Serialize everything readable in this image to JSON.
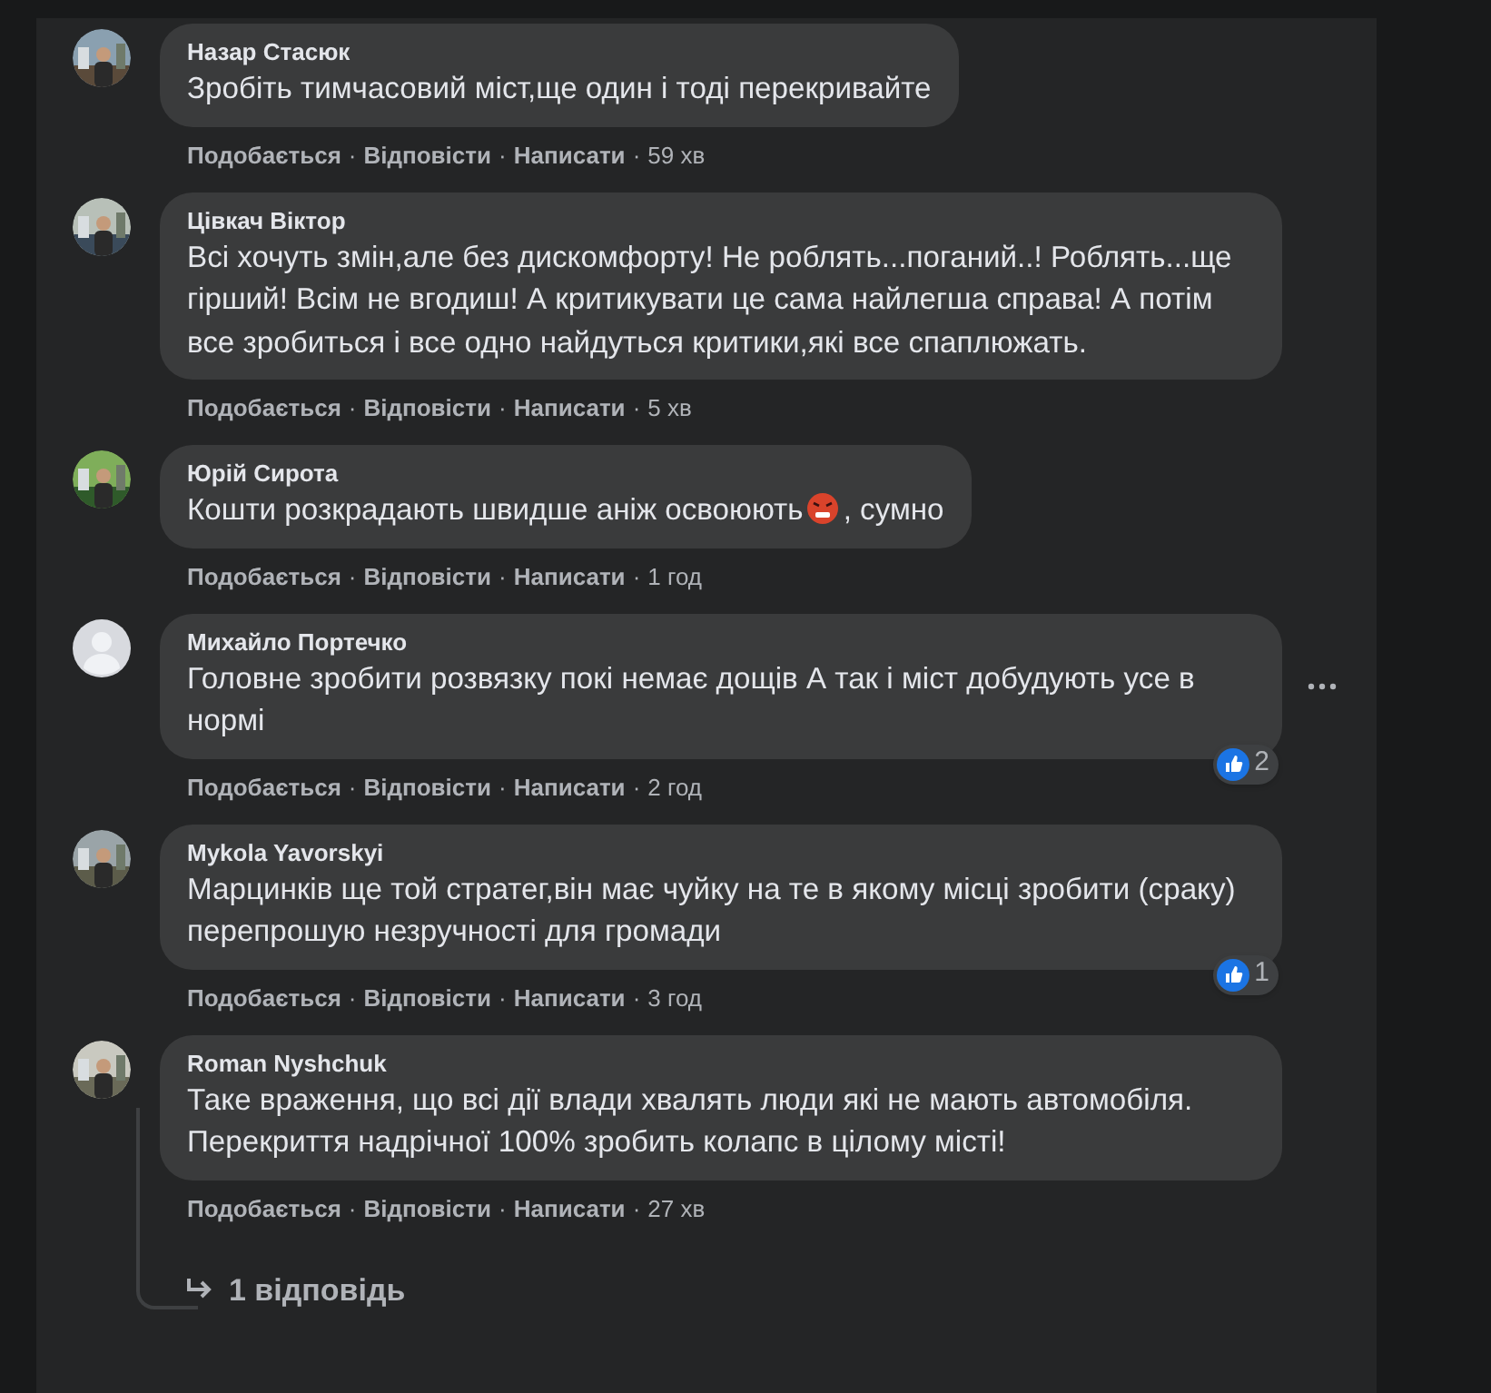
{
  "separator": "·",
  "comments": [
    {
      "author": "Назар Стасюк",
      "text": "Зробіть тимчасовий міст,ще один і тоді перекривайте",
      "actions": [
        "Подобається",
        "Відповісти",
        "Написати"
      ],
      "time": "59 хв"
    },
    {
      "author": "Цівкач Віктор",
      "text": "Всі хочуть змін,але без дискомфорту! Не роблять...поганий..! Роблять...ще гірший! Всім не вгодиш! А критикувати це сама найлегша справа! А потім все зробиться і все одно найдуться критики,які все спаплюжать.",
      "actions": [
        "Подобається",
        "Відповісти",
        "Написати"
      ],
      "time": "5 хв"
    },
    {
      "author": "Юрій Сирота",
      "text": "Кошти розкрадають швидше аніж освоюють",
      "emoji": {
        "kind": "angry"
      },
      "text_after": ", сумно",
      "actions": [
        "Подобається",
        "Відповісти",
        "Написати"
      ],
      "time": "1 год"
    },
    {
      "author": "Михайло Портечко",
      "avatar": {
        "kind": "default"
      },
      "text": "Головне зробити розвязку покі немає дощів А так і міст добудують усе в нормі",
      "actions": [
        "Подобається",
        "Відповісти",
        "Написати"
      ],
      "time": "2 год",
      "likes": "2",
      "menu": true
    },
    {
      "author": "Mykola Yavorskyi",
      "text": "Марцинків ще той стратег,він має чуйку на те в якому місці зробити (сраку) перепрошую незручності для громади",
      "actions": [
        "Подобається",
        "Відповісти",
        "Написати"
      ],
      "time": "3 год",
      "likes": "1"
    },
    {
      "author": "Roman Nyshchuk",
      "text": "Таке враження, що всі дії влади хвалять люди які не мають автомобіля. Перекриття надрічної 100% зробить колапс в цілому місті!",
      "actions": [
        "Подобається",
        "Відповісти",
        "Написати"
      ],
      "time": "27 хв",
      "replies": "1 відповідь"
    }
  ]
}
